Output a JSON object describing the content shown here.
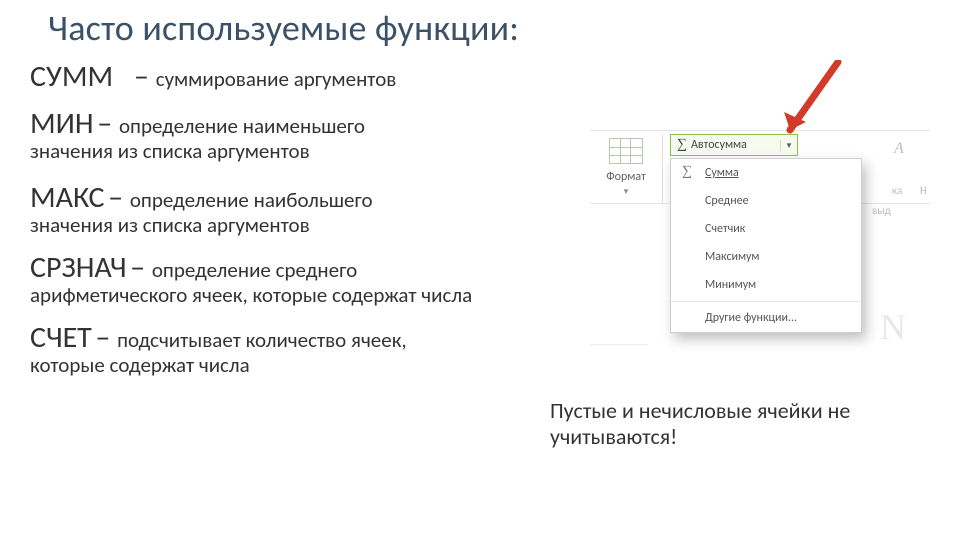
{
  "title": "Часто используемые функции:",
  "functions": {
    "sum": {
      "name": "СУММ",
      "dash": "– ",
      "desc_big": "суммирование аргументов"
    },
    "min": {
      "name": "МИН",
      "dash": "– ",
      "desc_big": "определение наименьшего",
      "desc_small": "значения из списка аргументов"
    },
    "max": {
      "name": "МАКС",
      "dash": "– ",
      "desc_big": "определение наибольшего",
      "desc_small": "значения из списка аргументов"
    },
    "avg": {
      "name": "СРЗНАЧ",
      "dash": "– ",
      "desc_big": "определение среднего",
      "desc_small": "арифметического ячеек, которые содержат числа"
    },
    "count": {
      "name": "СЧЕТ",
      "dash": "– ",
      "desc_big": "подсчитывает количество ячеек,",
      "desc_small": "которые содержат числа"
    }
  },
  "note": "Пустые и нечисловые ячейки не учитываются!",
  "screenshot": {
    "format_label": "Формат",
    "autosum_label": "Автосумма",
    "menu": {
      "sum": "Сумма",
      "avg": "Среднее",
      "count": "Счетчик",
      "max": "Максимум",
      "min": "Минимум",
      "other": "Другие функции..."
    },
    "faded_right1": "А",
    "faded_right2": "ка",
    "faded_right3": "выд",
    "faded_top": "Н"
  }
}
